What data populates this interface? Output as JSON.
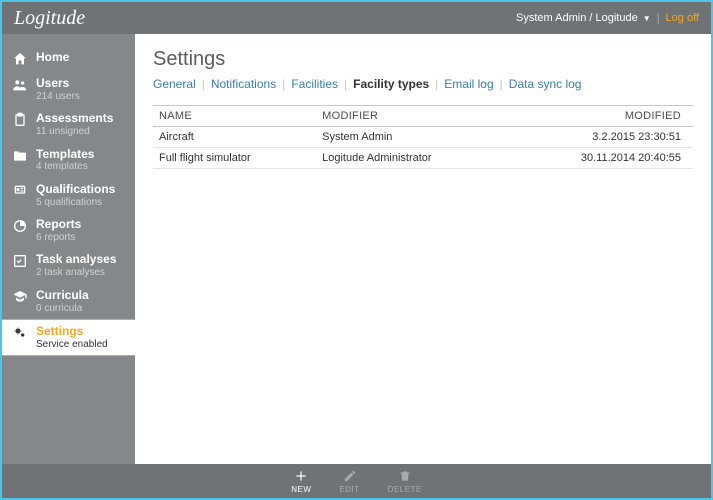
{
  "app_name": "Logitude",
  "header": {
    "user_context": "System Admin / Logitude",
    "logoff_label": "Log off"
  },
  "sidebar": {
    "items": [
      {
        "label": "Home",
        "sub": ""
      },
      {
        "label": "Users",
        "sub": "214 users"
      },
      {
        "label": "Assessments",
        "sub": "11 unsigned"
      },
      {
        "label": "Templates",
        "sub": "4 templates"
      },
      {
        "label": "Qualifications",
        "sub": "5 qualifications"
      },
      {
        "label": "Reports",
        "sub": "6 reports"
      },
      {
        "label": "Task analyses",
        "sub": "2 task analyses"
      },
      {
        "label": "Curricula",
        "sub": "0 curricula"
      },
      {
        "label": "Settings",
        "sub": "Service enabled"
      }
    ],
    "active_index": 8
  },
  "page": {
    "title": "Settings",
    "tabs": [
      "General",
      "Notifications",
      "Facilities",
      "Facility types",
      "Email log",
      "Data sync log"
    ],
    "active_tab_index": 3
  },
  "table": {
    "headers": {
      "name": "NAME",
      "modifier": "MODIFIER",
      "modified": "MODIFIED"
    },
    "rows": [
      {
        "name": "Aircraft",
        "modifier": "System Admin",
        "modified": "3.2.2015 23:30:51"
      },
      {
        "name": "Full flight simulator",
        "modifier": "Logitude Administrator",
        "modified": "30.11.2014 20:40:55"
      }
    ]
  },
  "footer": {
    "new_label": "NEW",
    "edit_label": "EDIT",
    "delete_label": "DELETE"
  }
}
